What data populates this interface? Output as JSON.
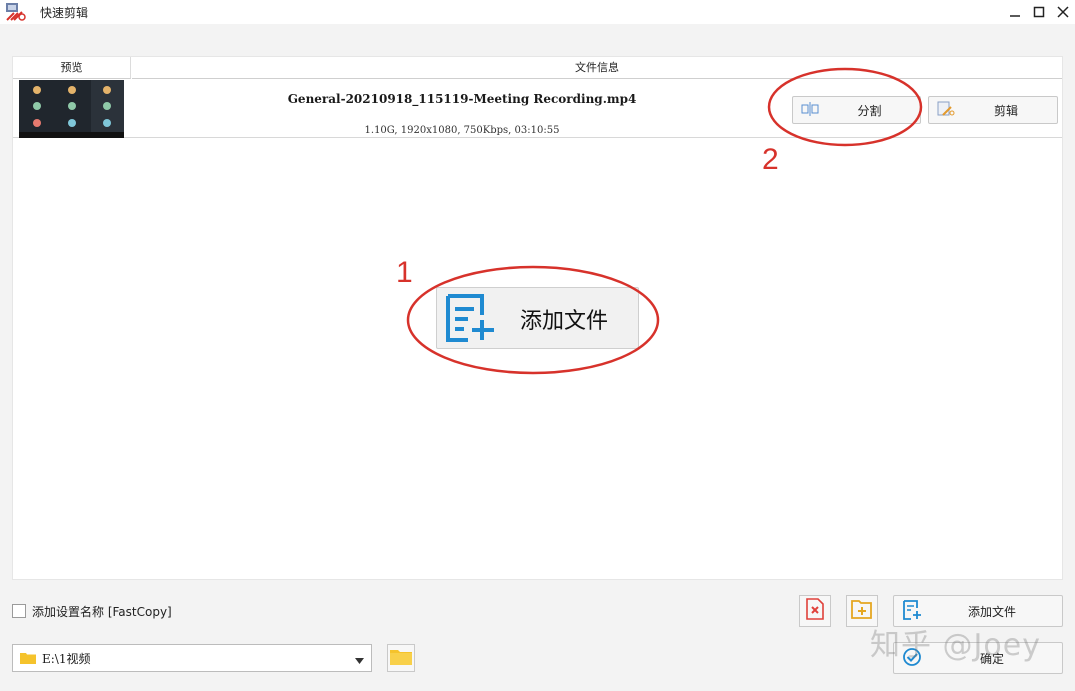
{
  "window": {
    "title": "快速剪辑",
    "controls": [
      "minimize-icon",
      "maximize-icon",
      "close-icon"
    ]
  },
  "table": {
    "headers": {
      "preview": "预览",
      "file_info": "文件信息"
    },
    "rows": [
      {
        "file_name": "General-20210918_115119-Meeting Recording.mp4",
        "meta": "1.10G, 1920x1080, 750Kbps, 03:10:55",
        "split_label": "分割",
        "edit_label": "剪辑"
      }
    ]
  },
  "center": {
    "add_file_label": "添加文件"
  },
  "annotations": {
    "mark_1": "1",
    "mark_2": "2",
    "color": "#d7322b"
  },
  "bottom": {
    "add_name_label": "添加设置名称 [FastCopy]",
    "add_name_checked": false,
    "path_value": "E:\\1视频",
    "add_file_label": "添加文件",
    "confirm_label": "确定"
  },
  "watermark": "知乎 @Joey",
  "colors": {
    "accent_blue": "#1f8ad1",
    "folder_yellow": "#f5c32c",
    "delete_red": "#e0413b"
  }
}
